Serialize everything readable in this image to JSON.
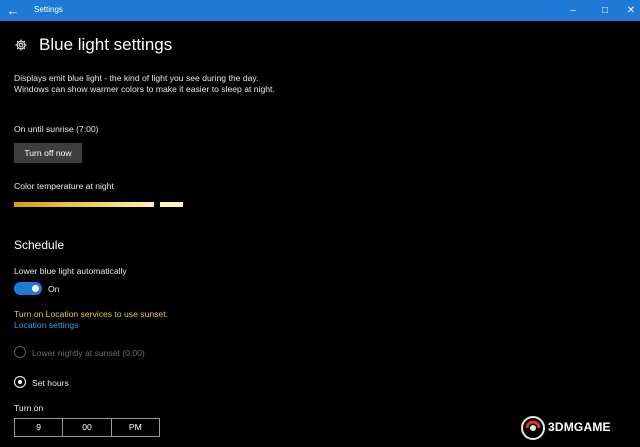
{
  "window": {
    "title": "Settings",
    "back_icon": "arrow-left-icon",
    "controls": [
      "minimize",
      "maximize",
      "close"
    ]
  },
  "page": {
    "icon": "gear-icon",
    "title": "Blue light settings",
    "description": "Displays emit blue light - the kind of light you see during the day. Windows can show warmer colors to make it easier to sleep at night.",
    "status": "On until sunrise (7:00)",
    "turn_off_label": "Turn off now"
  },
  "color_temperature": {
    "label": "Color temperature at night",
    "level": 0.85,
    "colors": {
      "warm": "#d99b12",
      "cool": "#fff4b2"
    }
  },
  "schedule": {
    "heading": "Schedule",
    "auto_label": "Lower blue light automatically",
    "toggle_on": true,
    "toggle_state": "On",
    "location_warning": "Turn on Location services to use sunset.",
    "location_link": "Location settings",
    "options": [
      {
        "label": "Lower nightly at sunset (0:00)",
        "selected": false,
        "enabled": false
      },
      {
        "label": "Set hours",
        "selected": true,
        "enabled": true
      }
    ],
    "turn_on_label": "Turn on",
    "turn_on_time": {
      "hour": "9",
      "minute": "00",
      "period": "PM"
    }
  },
  "watermark": {
    "text": "3DMGAME"
  },
  "colors": {
    "accent": "#1e7ad6",
    "warning": "#e6c93a",
    "link": "#3c9fe0",
    "background": "#000000"
  }
}
